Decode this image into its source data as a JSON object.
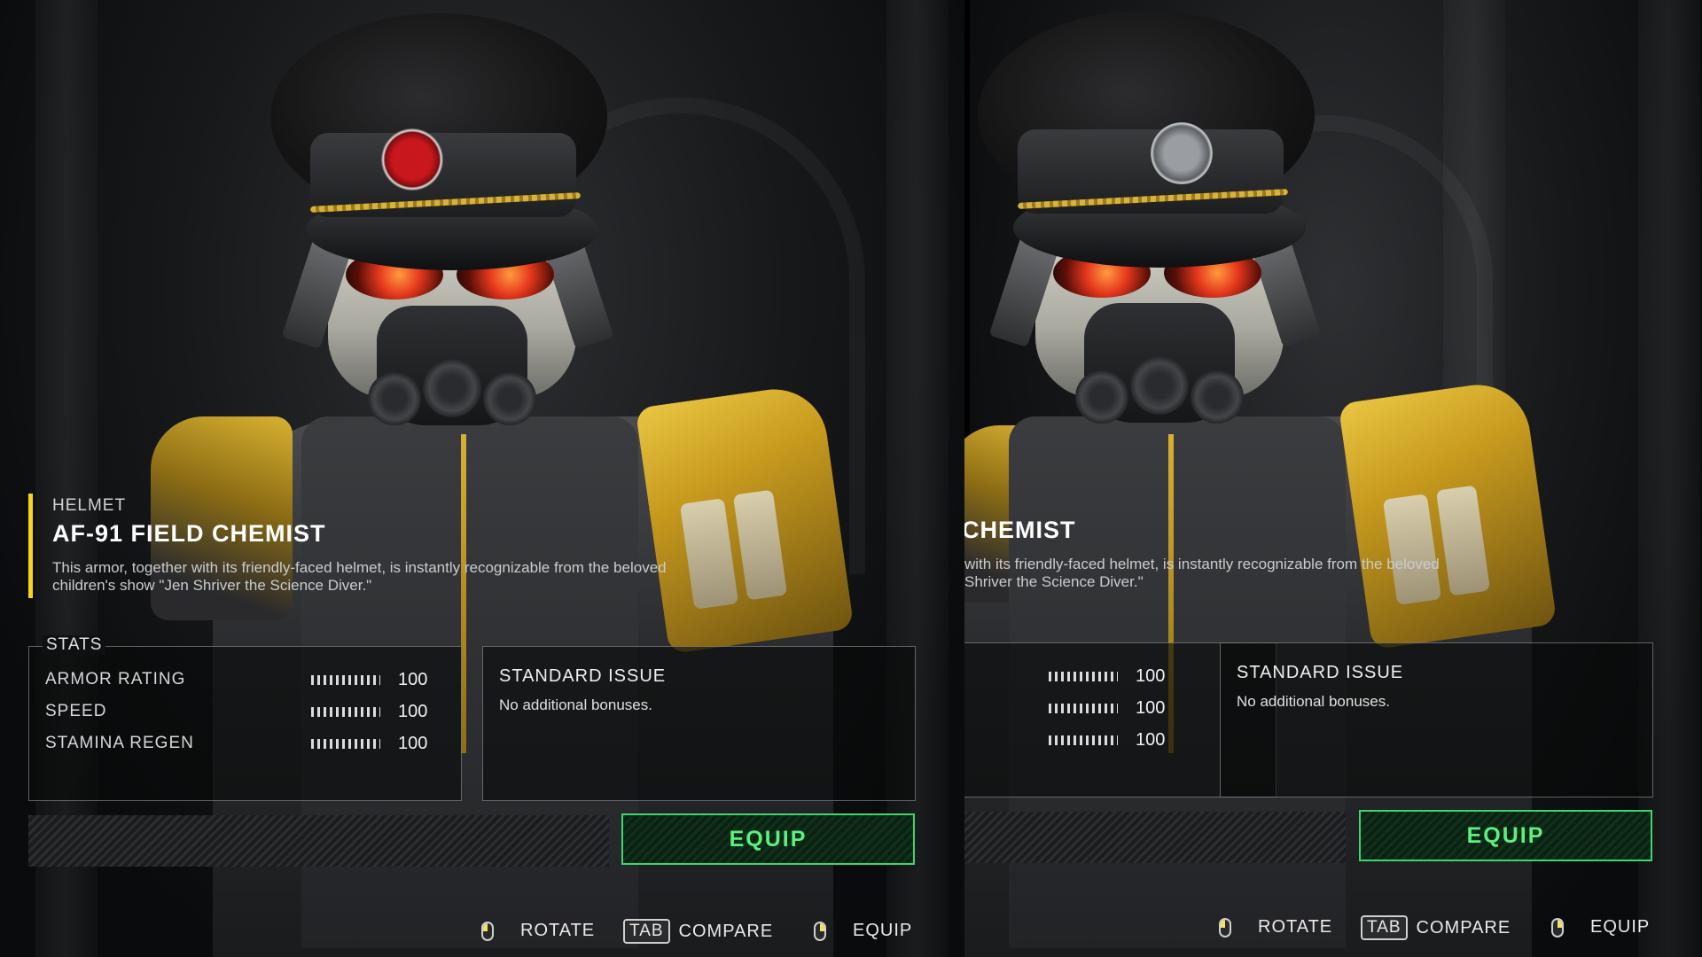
{
  "panels": [
    {
      "id": "left",
      "item_type": "HELMET",
      "item_name": "AF-91 FIELD CHEMIST",
      "description_lines": [
        "This armor, together with its friendly-faced helmet, is instantly recognizable from the beloved",
        "children's show \"Jen Shriver the Science Diver.\""
      ],
      "stats_title": "STATS",
      "stats": [
        {
          "label": "ARMOR RATING",
          "value": "100",
          "fill": 1.0
        },
        {
          "label": "SPEED",
          "value": "100",
          "fill": 1.0
        },
        {
          "label": "STAMINA REGEN",
          "value": "100",
          "fill": 1.0
        }
      ],
      "passive_title": "STANDARD ISSUE",
      "passive_desc": "No additional bonuses.",
      "equip_label": "EQUIP",
      "badge_color": "#c8171d",
      "hints": [
        {
          "icon": "mouse-left-icon",
          "label": "ROTATE"
        },
        {
          "icon": "tab-key-icon",
          "key": "TAB",
          "label": "COMPARE"
        },
        {
          "icon": "mouse-right-icon",
          "label": "EQUIP"
        }
      ]
    },
    {
      "id": "right",
      "item_name": "CHEMIST",
      "description_lines": [
        "with its friendly-faced helmet, is instantly recognizable from the beloved",
        "Shriver the Science Diver.\""
      ],
      "stats": [
        {
          "value": "100",
          "fill": 1.0
        },
        {
          "value": "100",
          "fill": 1.0
        },
        {
          "value": "100",
          "fill": 1.0
        }
      ],
      "passive_title": "STANDARD ISSUE",
      "passive_desc": "No additional bonuses.",
      "equip_label": "EQUIP",
      "badge_color": "#9a9ea2",
      "hints": [
        {
          "icon": "mouse-left-icon",
          "label": "ROTATE"
        },
        {
          "icon": "tab-key-icon",
          "key": "TAB",
          "label": "COMPARE"
        },
        {
          "icon": "mouse-right-icon",
          "label": "EQUIP"
        }
      ]
    }
  ],
  "colors": {
    "accent_yellow": "#f5d61c",
    "equip_green": "#3fd46f",
    "armor_gold": "#d9b232"
  }
}
